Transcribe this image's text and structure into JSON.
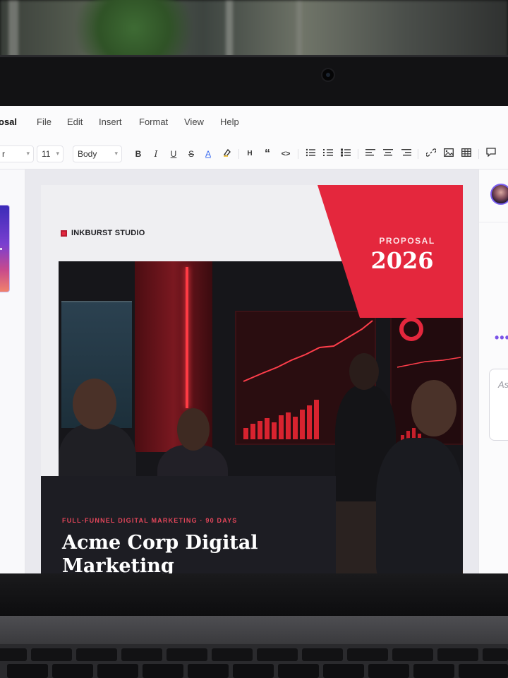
{
  "menubar": {
    "doc_title": "osal",
    "items": [
      "File",
      "Edit",
      "Insert",
      "Format",
      "View",
      "Help"
    ]
  },
  "toolbar": {
    "font_family": "r",
    "font_size": "11",
    "style": "Body",
    "bold": "B",
    "italic": "I",
    "underline": "U",
    "strike": "S",
    "text_color": "A",
    "heading": "H",
    "quote": "“",
    "code": "<>"
  },
  "document": {
    "brand": "INKBURST STUDIO",
    "proposal_kicker": "PROPOSAL",
    "year": "2026",
    "caption_kicker": "FULL-FUNNEL DIGITAL MARKETING · 90 DAYS",
    "title": "Acme Corp Digital Marketing"
  },
  "assistant": {
    "input_placeholder": "As"
  },
  "colors": {
    "accent_red": "#e4273d",
    "accent_purple": "#7b53e8",
    "dark_block": "#1d1d23"
  }
}
